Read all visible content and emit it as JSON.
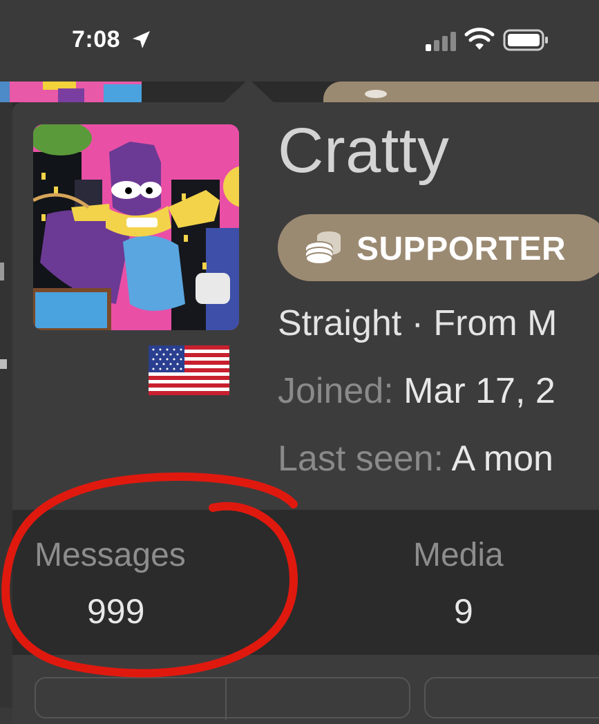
{
  "status_bar": {
    "time": "7:08",
    "icons": [
      "location-arrow-icon",
      "cellular-signal-icon",
      "wifi-icon",
      "battery-icon"
    ]
  },
  "profile": {
    "username": "Cratty",
    "badge": {
      "label": "SUPPORTER",
      "icon": "coin-stack-icon",
      "color": "#9b8a72"
    },
    "info_line": "Straight · From M",
    "joined_label": "Joined:",
    "joined_value": " Mar 17, 2",
    "last_seen_label": "Last seen:",
    "last_seen_value": " A mon",
    "avatar": "cartoon-hero-avatar",
    "flag": "us-flag-icon"
  },
  "stats": [
    {
      "label": "Messages",
      "value": "999"
    },
    {
      "label": "Media",
      "value": "9"
    }
  ],
  "colors": {
    "background": "#3d3c3c",
    "stats_background": "#2b2b2b",
    "annotation_circle": "#e0190f"
  }
}
